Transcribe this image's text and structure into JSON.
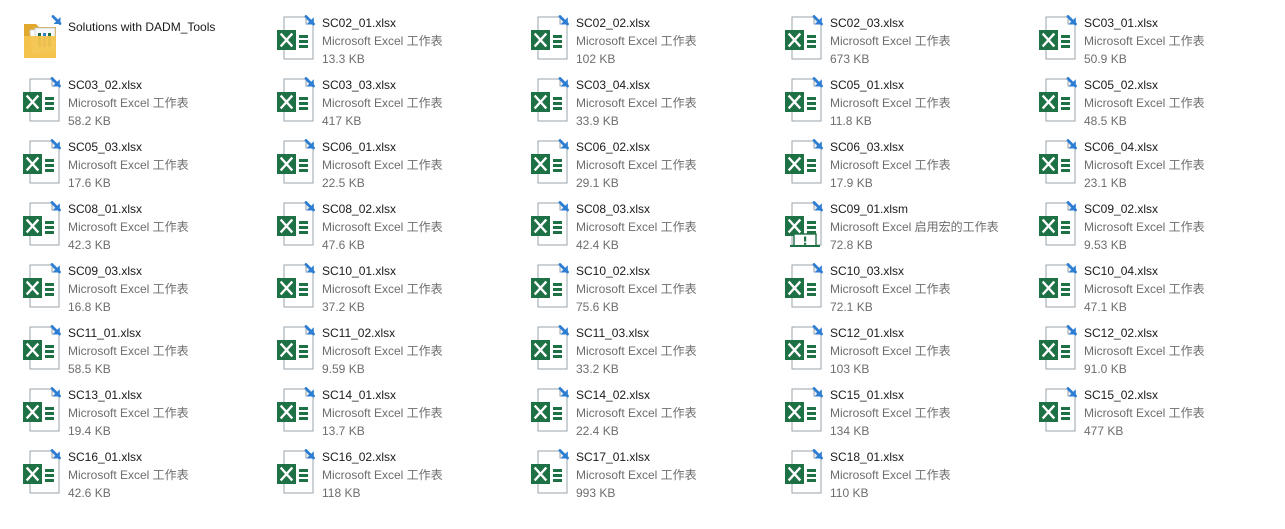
{
  "explorer": {
    "items": [
      {
        "kind": "folder",
        "name": "Solutions with DADM_Tools",
        "type": "",
        "size": ""
      },
      {
        "kind": "xlsx",
        "name": "SC02_01.xlsx",
        "type": "Microsoft Excel 工作表",
        "size": "13.3 KB"
      },
      {
        "kind": "xlsx",
        "name": "SC02_02.xlsx",
        "type": "Microsoft Excel 工作表",
        "size": "102 KB"
      },
      {
        "kind": "xlsx",
        "name": "SC02_03.xlsx",
        "type": "Microsoft Excel 工作表",
        "size": "673 KB"
      },
      {
        "kind": "xlsx",
        "name": "SC03_01.xlsx",
        "type": "Microsoft Excel 工作表",
        "size": "50.9 KB"
      },
      {
        "kind": "xlsx",
        "name": "SC03_02.xlsx",
        "type": "Microsoft Excel 工作表",
        "size": "58.2 KB"
      },
      {
        "kind": "xlsx",
        "name": "SC03_03.xlsx",
        "type": "Microsoft Excel 工作表",
        "size": "417 KB"
      },
      {
        "kind": "xlsx",
        "name": "SC03_04.xlsx",
        "type": "Microsoft Excel 工作表",
        "size": "33.9 KB"
      },
      {
        "kind": "xlsx",
        "name": "SC05_01.xlsx",
        "type": "Microsoft Excel 工作表",
        "size": "11.8 KB"
      },
      {
        "kind": "xlsx",
        "name": "SC05_02.xlsx",
        "type": "Microsoft Excel 工作表",
        "size": "48.5 KB"
      },
      {
        "kind": "xlsx",
        "name": "SC05_03.xlsx",
        "type": "Microsoft Excel 工作表",
        "size": "17.6 KB"
      },
      {
        "kind": "xlsx",
        "name": "SC06_01.xlsx",
        "type": "Microsoft Excel 工作表",
        "size": "22.5 KB"
      },
      {
        "kind": "xlsx",
        "name": "SC06_02.xlsx",
        "type": "Microsoft Excel 工作表",
        "size": "29.1 KB"
      },
      {
        "kind": "xlsx",
        "name": "SC06_03.xlsx",
        "type": "Microsoft Excel 工作表",
        "size": "17.9 KB"
      },
      {
        "kind": "xlsx",
        "name": "SC06_04.xlsx",
        "type": "Microsoft Excel 工作表",
        "size": "23.1 KB"
      },
      {
        "kind": "xlsx",
        "name": "SC08_01.xlsx",
        "type": "Microsoft Excel 工作表",
        "size": "42.3 KB"
      },
      {
        "kind": "xlsx",
        "name": "SC08_02.xlsx",
        "type": "Microsoft Excel 工作表",
        "size": "47.6 KB"
      },
      {
        "kind": "xlsx",
        "name": "SC08_03.xlsx",
        "type": "Microsoft Excel 工作表",
        "size": "42.4 KB"
      },
      {
        "kind": "xlsm",
        "name": "SC09_01.xlsm",
        "type": "Microsoft Excel 启用宏的工作表",
        "size": "72.8 KB"
      },
      {
        "kind": "xlsx",
        "name": "SC09_02.xlsx",
        "type": "Microsoft Excel 工作表",
        "size": "9.53 KB"
      },
      {
        "kind": "xlsx",
        "name": "SC09_03.xlsx",
        "type": "Microsoft Excel 工作表",
        "size": "16.8 KB"
      },
      {
        "kind": "xlsx",
        "name": "SC10_01.xlsx",
        "type": "Microsoft Excel 工作表",
        "size": "37.2 KB"
      },
      {
        "kind": "xlsx",
        "name": "SC10_02.xlsx",
        "type": "Microsoft Excel 工作表",
        "size": "75.6 KB"
      },
      {
        "kind": "xlsx",
        "name": "SC10_03.xlsx",
        "type": "Microsoft Excel 工作表",
        "size": "72.1 KB"
      },
      {
        "kind": "xlsx",
        "name": "SC10_04.xlsx",
        "type": "Microsoft Excel 工作表",
        "size": "47.1 KB"
      },
      {
        "kind": "xlsx",
        "name": "SC11_01.xlsx",
        "type": "Microsoft Excel 工作表",
        "size": "58.5 KB"
      },
      {
        "kind": "xlsx",
        "name": "SC11_02.xlsx",
        "type": "Microsoft Excel 工作表",
        "size": "9.59 KB"
      },
      {
        "kind": "xlsx",
        "name": "SC11_03.xlsx",
        "type": "Microsoft Excel 工作表",
        "size": "33.2 KB"
      },
      {
        "kind": "xlsx",
        "name": "SC12_01.xlsx",
        "type": "Microsoft Excel 工作表",
        "size": "103 KB"
      },
      {
        "kind": "xlsx",
        "name": "SC12_02.xlsx",
        "type": "Microsoft Excel 工作表",
        "size": "91.0 KB"
      },
      {
        "kind": "xlsx",
        "name": "SC13_01.xlsx",
        "type": "Microsoft Excel 工作表",
        "size": "19.4 KB"
      },
      {
        "kind": "xlsx",
        "name": "SC14_01.xlsx",
        "type": "Microsoft Excel 工作表",
        "size": "13.7 KB"
      },
      {
        "kind": "xlsx",
        "name": "SC14_02.xlsx",
        "type": "Microsoft Excel 工作表",
        "size": "22.4 KB"
      },
      {
        "kind": "xlsx",
        "name": "SC15_01.xlsx",
        "type": "Microsoft Excel 工作表",
        "size": "134 KB"
      },
      {
        "kind": "xlsx",
        "name": "SC15_02.xlsx",
        "type": "Microsoft Excel 工作表",
        "size": "477 KB"
      },
      {
        "kind": "xlsx",
        "name": "SC16_01.xlsx",
        "type": "Microsoft Excel 工作表",
        "size": "42.6 KB"
      },
      {
        "kind": "xlsx",
        "name": "SC16_02.xlsx",
        "type": "Microsoft Excel 工作表",
        "size": "118 KB"
      },
      {
        "kind": "xlsx",
        "name": "SC17_01.xlsx",
        "type": "Microsoft Excel 工作表",
        "size": "993 KB"
      },
      {
        "kind": "xlsx",
        "name": "SC18_01.xlsx",
        "type": "Microsoft Excel 工作表",
        "size": "110 KB"
      }
    ]
  },
  "icons": {
    "xlsx": "excel-workbook-icon",
    "xlsm": "excel-macro-workbook-icon",
    "folder": "folder-icon",
    "shortcut_overlay": "cloud-sync-arrow-icon"
  },
  "colors": {
    "excel_green": "#1e7145",
    "excel_dark_green": "#185c37",
    "sync_blue": "#2d7dd2",
    "folder_yellow": "#f4c44e",
    "name_text": "#1a1a1a",
    "detail_text": "#6d6d6d"
  }
}
